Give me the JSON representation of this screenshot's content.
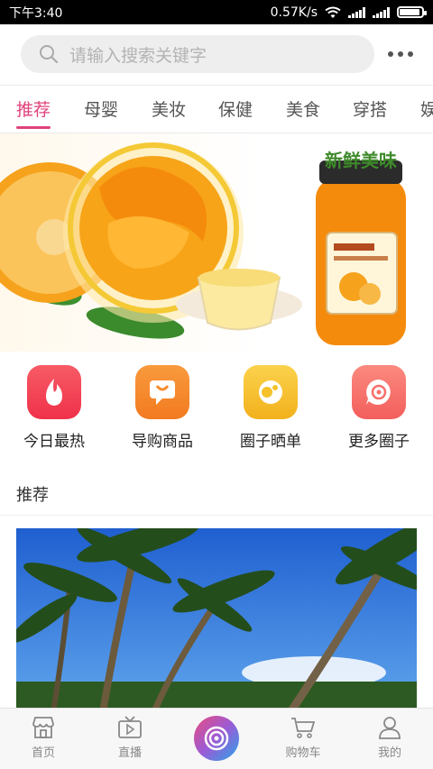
{
  "status_bar": {
    "time": "下午3:40",
    "net_speed": "0.57K/s"
  },
  "search": {
    "placeholder": "请输入搜索关键字"
  },
  "tabs": [
    {
      "label": "推荐",
      "active": true
    },
    {
      "label": "母婴"
    },
    {
      "label": "美妆"
    },
    {
      "label": "保健"
    },
    {
      "label": "美食"
    },
    {
      "label": "穿搭"
    },
    {
      "label": "娱"
    }
  ],
  "banner": {
    "title": "新鲜美味"
  },
  "quick_menu": [
    {
      "label": "今日最热",
      "icon": "flame-icon",
      "color": "#f0445b"
    },
    {
      "label": "导购商品",
      "icon": "shopping-bag-icon",
      "color": "#f58a2b"
    },
    {
      "label": "圈子晒单",
      "icon": "circle-share-icon",
      "color": "#f5c22b"
    },
    {
      "label": "更多圈子",
      "icon": "chat-ring-icon",
      "color": "#f76f6a"
    }
  ],
  "section": {
    "title": "推荐"
  },
  "bottom_nav": [
    {
      "label": "首页",
      "icon": "store-icon"
    },
    {
      "label": "直播",
      "icon": "tv-play-icon"
    },
    {
      "label": "",
      "icon": "center-ring-icon"
    },
    {
      "label": "购物车",
      "icon": "cart-icon"
    },
    {
      "label": "我的",
      "icon": "user-icon"
    }
  ],
  "colors": {
    "accent": "#e0427c"
  }
}
